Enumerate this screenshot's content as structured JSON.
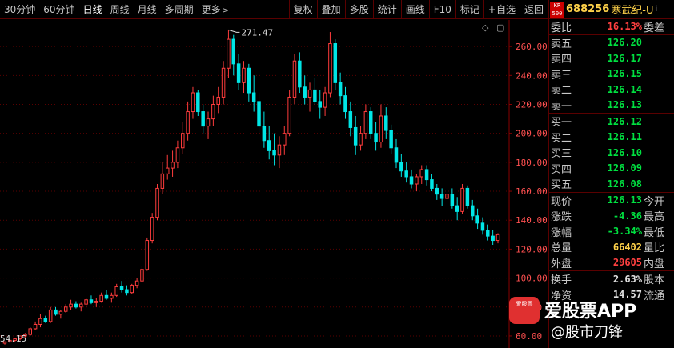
{
  "periods": [
    {
      "label": "30分钟"
    },
    {
      "label": "60分钟"
    },
    {
      "label": "日线"
    },
    {
      "label": "周线"
    },
    {
      "label": "月线"
    },
    {
      "label": "多周期"
    },
    {
      "label": "更多",
      "chev": ">"
    }
  ],
  "tools": [
    "复权",
    "叠加",
    "多股",
    "统计",
    "画线",
    "F10",
    "标记",
    "+自选",
    "返回"
  ],
  "chart_data": {
    "type": "candlestick",
    "y_ticks": [
      "260.00",
      "240.00",
      "220.00",
      "200.00",
      "180.00",
      "160.00",
      "140.00",
      "120.00",
      "100.00",
      "80.00",
      "60.00"
    ],
    "ylim": [
      55,
      275
    ],
    "max_annotation": "271.47",
    "min_annotation": "54.15",
    "up_color": "#ff3c3c",
    "down_color": "#00e6e6",
    "candles": [
      [
        55,
        56,
        54,
        56
      ],
      [
        56,
        57,
        55,
        57
      ],
      [
        57,
        58,
        56,
        58
      ],
      [
        58,
        60,
        57,
        60
      ],
      [
        60,
        62,
        59,
        61
      ],
      [
        61,
        66,
        60,
        65
      ],
      [
        65,
        70,
        64,
        68
      ],
      [
        68,
        75,
        66,
        72
      ],
      [
        72,
        74,
        69,
        70
      ],
      [
        70,
        80,
        69,
        78
      ],
      [
        78,
        80,
        74,
        75
      ],
      [
        75,
        78,
        72,
        77
      ],
      [
        77,
        82,
        76,
        80
      ],
      [
        80,
        85,
        78,
        82
      ],
      [
        82,
        84,
        79,
        80
      ],
      [
        80,
        83,
        77,
        82
      ],
      [
        82,
        86,
        80,
        85
      ],
      [
        85,
        88,
        82,
        83
      ],
      [
        83,
        86,
        80,
        84
      ],
      [
        84,
        90,
        83,
        88
      ],
      [
        88,
        92,
        85,
        86
      ],
      [
        86,
        90,
        83,
        88
      ],
      [
        88,
        96,
        87,
        94
      ],
      [
        94,
        98,
        90,
        92
      ],
      [
        92,
        95,
        88,
        90
      ],
      [
        90,
        96,
        89,
        95
      ],
      [
        95,
        100,
        93,
        98
      ],
      [
        98,
        108,
        97,
        106
      ],
      [
        106,
        128,
        105,
        126
      ],
      [
        126,
        145,
        124,
        142
      ],
      [
        142,
        165,
        140,
        162
      ],
      [
        162,
        180,
        158,
        172
      ],
      [
        172,
        185,
        168,
        176
      ],
      [
        176,
        188,
        170,
        180
      ],
      [
        180,
        195,
        176,
        190
      ],
      [
        190,
        208,
        186,
        200
      ],
      [
        200,
        222,
        195,
        215
      ],
      [
        215,
        232,
        210,
        228
      ],
      [
        228,
        230,
        212,
        215
      ],
      [
        215,
        220,
        200,
        205
      ],
      [
        205,
        215,
        196,
        210
      ],
      [
        210,
        226,
        205,
        220
      ],
      [
        220,
        232,
        214,
        225
      ],
      [
        225,
        250,
        220,
        245
      ],
      [
        245,
        271.47,
        238,
        265
      ],
      [
        265,
        268,
        240,
        248
      ],
      [
        248,
        255,
        230,
        235
      ],
      [
        235,
        250,
        228,
        245
      ],
      [
        245,
        248,
        222,
        228
      ],
      [
        228,
        240,
        215,
        222
      ],
      [
        222,
        228,
        200,
        205
      ],
      [
        205,
        215,
        190,
        195
      ],
      [
        195,
        205,
        182,
        188
      ],
      [
        188,
        200,
        178,
        185
      ],
      [
        185,
        198,
        176,
        192
      ],
      [
        192,
        205,
        185,
        200
      ],
      [
        200,
        230,
        198,
        225
      ],
      [
        225,
        255,
        220,
        250
      ],
      [
        250,
        256,
        228,
        232
      ],
      [
        232,
        240,
        220,
        225
      ],
      [
        225,
        235,
        215,
        230
      ],
      [
        230,
        238,
        220,
        222
      ],
      [
        222,
        230,
        210,
        218
      ],
      [
        218,
        232,
        212,
        228
      ],
      [
        228,
        270,
        225,
        262
      ],
      [
        262,
        265,
        230,
        235
      ],
      [
        235,
        242,
        220,
        226
      ],
      [
        226,
        232,
        210,
        215
      ],
      [
        215,
        222,
        198,
        204
      ],
      [
        204,
        212,
        185,
        192
      ],
      [
        192,
        205,
        188,
        200
      ],
      [
        200,
        220,
        196,
        215
      ],
      [
        215,
        218,
        196,
        200
      ],
      [
        200,
        208,
        188,
        194
      ],
      [
        194,
        220,
        190,
        212
      ],
      [
        212,
        218,
        196,
        202
      ],
      [
        202,
        206,
        186,
        190
      ],
      [
        190,
        196,
        176,
        180
      ],
      [
        180,
        186,
        170,
        174
      ],
      [
        174,
        180,
        166,
        170
      ],
      [
        170,
        175,
        162,
        165
      ],
      [
        165,
        172,
        160,
        170
      ],
      [
        170,
        178,
        165,
        175
      ],
      [
        175,
        178,
        164,
        168
      ],
      [
        168,
        172,
        160,
        162
      ],
      [
        162,
        165,
        154,
        158
      ],
      [
        158,
        162,
        150,
        155
      ],
      [
        155,
        160,
        152,
        158
      ],
      [
        158,
        162,
        148,
        150
      ],
      [
        150,
        156,
        140,
        146
      ],
      [
        146,
        165,
        144,
        162
      ],
      [
        162,
        164,
        148,
        150
      ],
      [
        150,
        154,
        140,
        143
      ],
      [
        143,
        148,
        134,
        138
      ],
      [
        138,
        142,
        130,
        133
      ],
      [
        133,
        137,
        126,
        129
      ],
      [
        129,
        133,
        123,
        126
      ],
      [
        126,
        131,
        124,
        130
      ]
    ]
  },
  "quote": {
    "market_badge": "KR\n500",
    "code": "688256",
    "name": "寒武纪-U",
    "info_icon": "i",
    "webi": {
      "label": "委比",
      "value": "16.13%",
      "label2": "委差"
    },
    "asks": [
      {
        "label": "卖五",
        "price": "126.20"
      },
      {
        "label": "卖四",
        "price": "126.17"
      },
      {
        "label": "卖三",
        "price": "126.15"
      },
      {
        "label": "卖二",
        "price": "126.14"
      },
      {
        "label": "卖一",
        "price": "126.13"
      }
    ],
    "bids": [
      {
        "label": "买一",
        "price": "126.12"
      },
      {
        "label": "买二",
        "price": "126.11"
      },
      {
        "label": "买三",
        "price": "126.10"
      },
      {
        "label": "买四",
        "price": "126.09"
      },
      {
        "label": "买五",
        "price": "126.08"
      }
    ],
    "stats": [
      {
        "label": "现价",
        "value": "126.13",
        "label2": "今开",
        "color": "green"
      },
      {
        "label": "涨跌",
        "value": "-4.36",
        "label2": "最高",
        "color": "green"
      },
      {
        "label": "涨幅",
        "value": "-3.34%",
        "label2": "最低",
        "color": "green"
      },
      {
        "label": "总量",
        "value": "66402",
        "label2": "量比",
        "color": "yellow"
      },
      {
        "label": "外盘",
        "value": "29605",
        "label2": "内盘",
        "color": "red"
      }
    ],
    "stats2": [
      {
        "label": "换手",
        "value": "2.63%",
        "label2": "股本",
        "color": "white"
      },
      {
        "label": "净资",
        "value": "14.57",
        "label2": "流通",
        "color": "white"
      }
    ]
  },
  "watermark": {
    "logo_text": "爱股票",
    "app_text": "爱股票APP",
    "weibo_text": "@股市刀锋"
  }
}
